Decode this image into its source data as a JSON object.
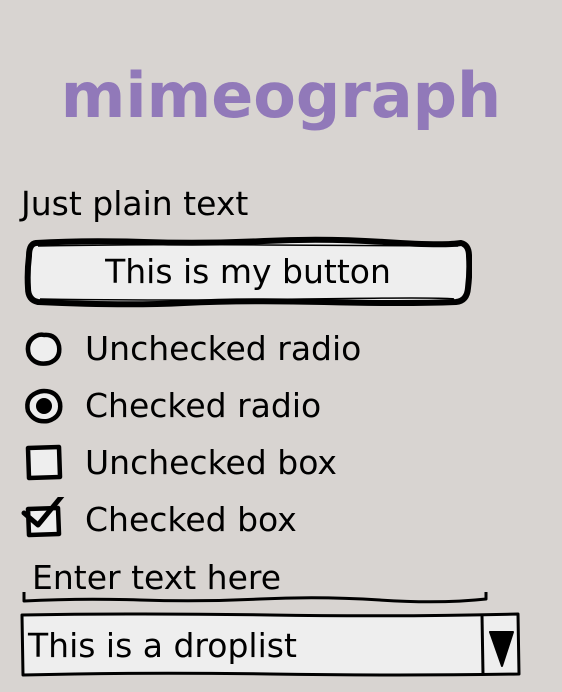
{
  "title": "mimeograph",
  "plain_text": "Just plain text",
  "button": {
    "label": "This is my button"
  },
  "options": [
    {
      "type": "radio",
      "label": "Unchecked radio",
      "checked": false
    },
    {
      "type": "radio",
      "label": "Checked radio",
      "checked": true
    },
    {
      "type": "checkbox",
      "label": "Unchecked box",
      "checked": false
    },
    {
      "type": "checkbox",
      "label": "Checked box",
      "checked": true
    }
  ],
  "text_input": {
    "value": "Enter text here"
  },
  "droplist": {
    "selected": "This is a droplist",
    "icon": "triangle-down-icon"
  },
  "colors": {
    "background": "#d8d4d1",
    "title": "#9179b9",
    "control_fill": "#eeeeee",
    "ink": "#000000"
  }
}
